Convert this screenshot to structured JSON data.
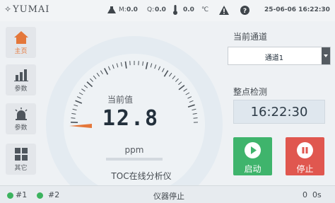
{
  "header": {
    "logo": "YUMAI",
    "m_label": "M:",
    "m_value": "0.0",
    "q_label": "Q:",
    "q_value": "0.0",
    "temp_value": "0.0",
    "temp_unit": "℃",
    "datetime": "25-06-06 16:22:30"
  },
  "nav": [
    {
      "label": "主页",
      "icon": "home-icon",
      "active": true
    },
    {
      "label": "参数",
      "icon": "bar-chart-icon",
      "active": false
    },
    {
      "label": "参数",
      "icon": "alarm-icon",
      "active": false
    },
    {
      "label": "其它",
      "icon": "grid-icon",
      "active": false
    }
  ],
  "gauge": {
    "label": "当前值",
    "value": "12.8",
    "unit": "ppm",
    "instrument": "TOC在线分析仪"
  },
  "right": {
    "channel_label": "当前通道",
    "channel_value": "通道1",
    "check_label": "整点检测",
    "check_time": "16:22:30",
    "start_label": "启动",
    "stop_label": "停止"
  },
  "status": {
    "ch1": "#1",
    "ch2": "#2",
    "state": "仪器停止",
    "count": "0",
    "elapsed": "0s"
  },
  "colors": {
    "accent": "#e4773a",
    "start": "#3fb46c",
    "stop": "#e0574f",
    "indicator": "#3cb35f"
  }
}
